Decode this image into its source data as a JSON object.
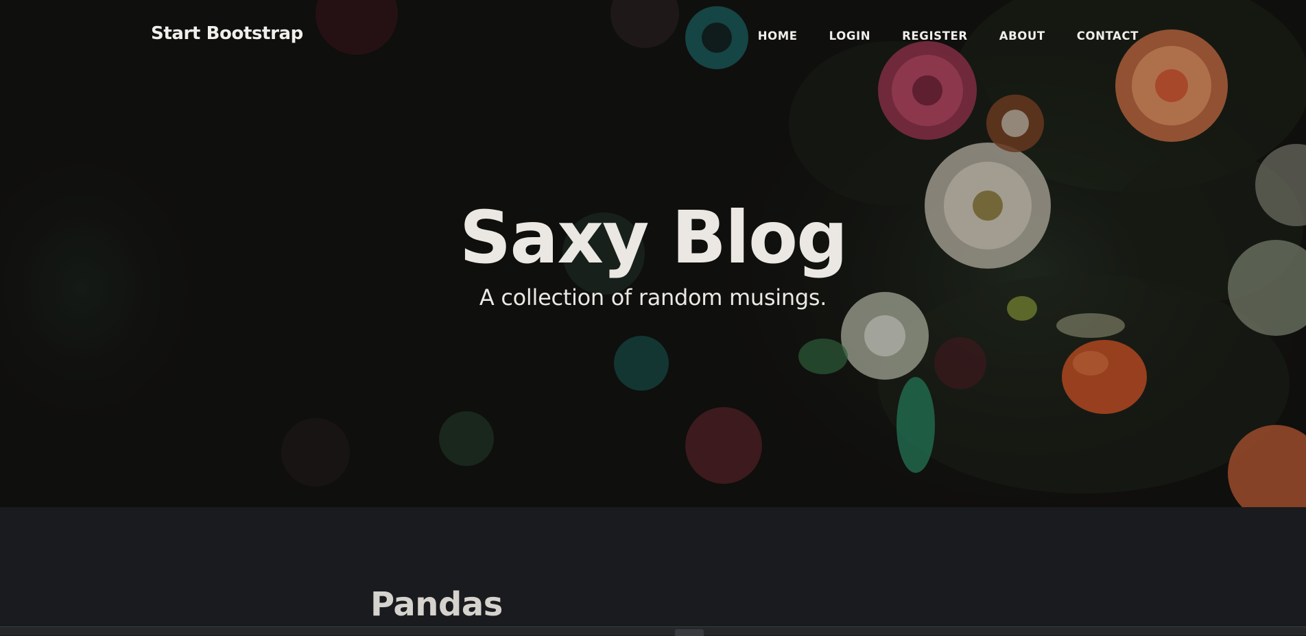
{
  "navbar": {
    "brand": "Start Bootstrap",
    "links": [
      "HOME",
      "LOGIN",
      "REGISTER",
      "ABOUT",
      "CONTACT"
    ]
  },
  "hero": {
    "title": "Saxy Blog",
    "subtitle": "A collection of random musings.",
    "background_image": "sea-anemones-photo"
  },
  "posts": [
    {
      "title": "Pandas"
    }
  ],
  "colors": {
    "page_bg": "#1a1b1e",
    "hero_text": "#ebe8e3",
    "post_title": "#d6d3ce"
  }
}
